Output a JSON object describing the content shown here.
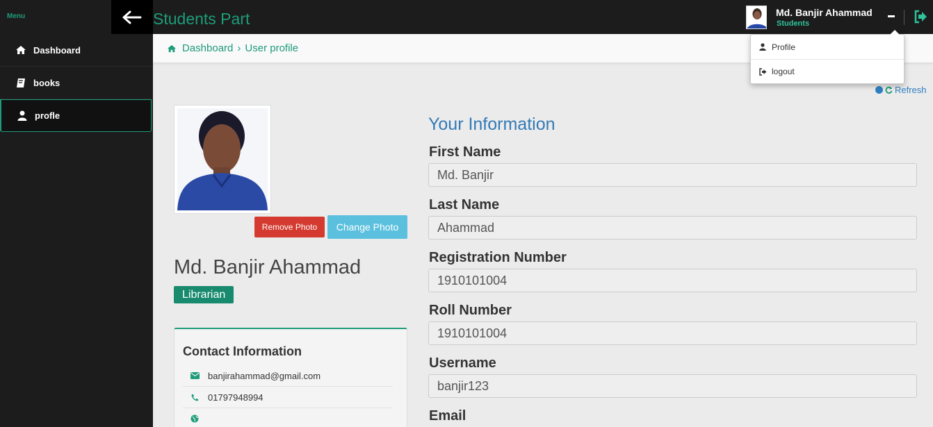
{
  "sidebar": {
    "menu_label": "Menu",
    "items": [
      {
        "label": "Dashboard",
        "icon": "home-icon"
      },
      {
        "label": "books",
        "icon": "book-icon"
      },
      {
        "label": "profle",
        "icon": "user-icon"
      }
    ]
  },
  "header": {
    "title": "Students Part",
    "user_name": "Md. Banjir Ahammad",
    "user_role": "Students"
  },
  "user_menu": {
    "items": [
      {
        "label": "Profile",
        "icon": "user-icon"
      },
      {
        "label": "logout",
        "icon": "sign-out-icon"
      }
    ]
  },
  "breadcrumb": {
    "home": "Dashboard",
    "separator": "›",
    "current": "User profile"
  },
  "refresh_label": "Refresh",
  "profile": {
    "remove_photo": "Remove Photo",
    "change_photo": "Change Photo",
    "name": "Md. Banjir Ahammad",
    "role": "Librarian"
  },
  "contact": {
    "title": "Contact Information",
    "email": "banjirahammad@gmail.com",
    "phone": "01797948994",
    "website": ""
  },
  "info": {
    "title": "Your Information",
    "fields": [
      {
        "label": "First Name",
        "value": "Md. Banjir"
      },
      {
        "label": "Last Name",
        "value": "Ahammad"
      },
      {
        "label": "Registration Number",
        "value": "1910101004"
      },
      {
        "label": "Roll Number",
        "value": "1910101004"
      },
      {
        "label": "Username",
        "value": "banjir123"
      },
      {
        "label": "Email",
        "value": ""
      }
    ]
  },
  "colors": {
    "accent": "#1e9c7a",
    "sidebar_bg": "#1c1c1c",
    "danger": "#d43a2f",
    "info": "#5bc0de",
    "link": "#337ab7"
  }
}
